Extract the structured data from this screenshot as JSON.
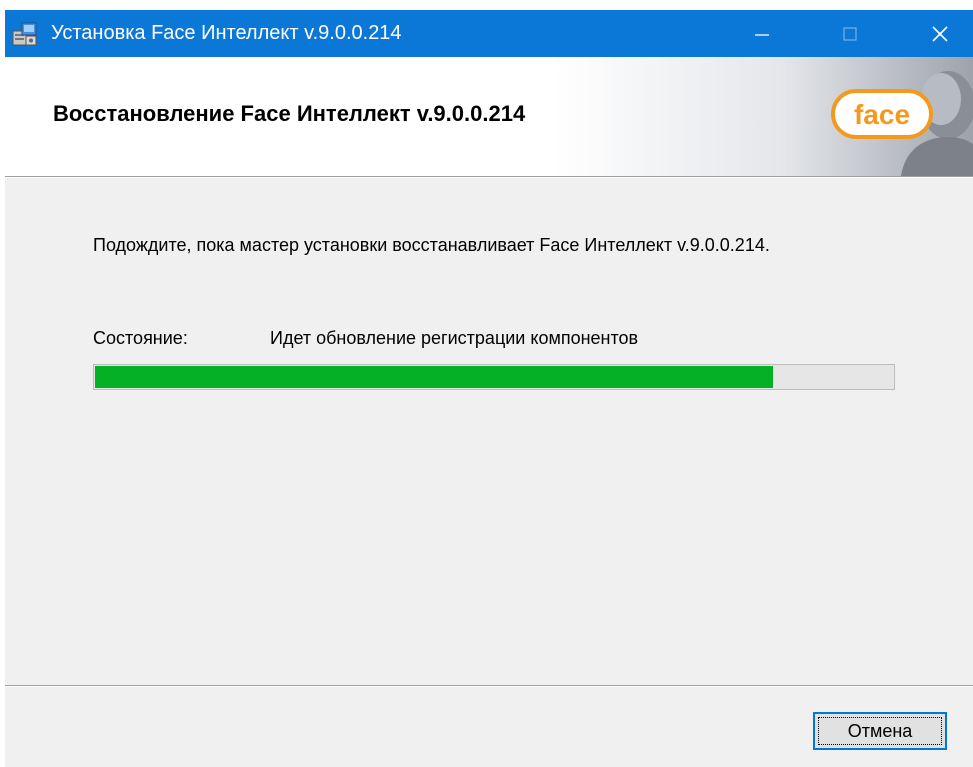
{
  "window": {
    "title": "Установка Face Интеллект v.9.0.0.214",
    "titlebar_color": "#0b78d7"
  },
  "header": {
    "title": "Восстановление Face Интеллект v.9.0.0.214",
    "logo_text": "face",
    "logo_color": "#f39a1e"
  },
  "content": {
    "message": "Подождите, пока мастер установки восстанавливает Face Интеллект v.9.0.0.214.",
    "status_label": "Состояние:",
    "status_value": "Идет обновление регистрации компонентов",
    "progress_fraction": 0.85,
    "progress_color": "#06b025"
  },
  "footer": {
    "cancel_label": "Отмена"
  }
}
